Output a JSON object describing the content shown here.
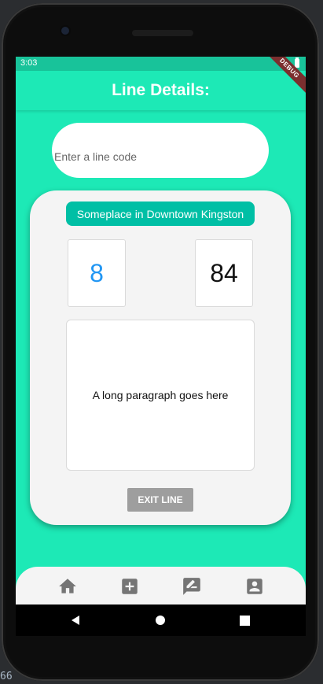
{
  "status_bar": {
    "time": "3:03",
    "debug_label": "DEBUG"
  },
  "app_bar": {
    "title": "Line Details:"
  },
  "line_code_input": {
    "placeholder": "Enter a line code",
    "value": ""
  },
  "card": {
    "location": "Someplace in Downtown Kingston",
    "number_left": "8",
    "number_right": "84",
    "paragraph": "A long paragraph goes here",
    "exit_label": "EXIT LINE"
  },
  "bottom_nav": {
    "items": [
      {
        "icon": "home-icon"
      },
      {
        "icon": "add-box-icon"
      },
      {
        "icon": "rate-review-icon"
      },
      {
        "icon": "account-box-icon"
      }
    ]
  },
  "colors": {
    "background": "#1de9b6",
    "status_bar": "#18c39a",
    "accent_pill": "#00bfa5",
    "number_accent": "#2196f3",
    "button_grey": "#9e9e9e"
  },
  "system_nav": {
    "buttons": [
      "back-icon",
      "home-circle-icon",
      "recents-icon"
    ]
  },
  "background_text": "66"
}
